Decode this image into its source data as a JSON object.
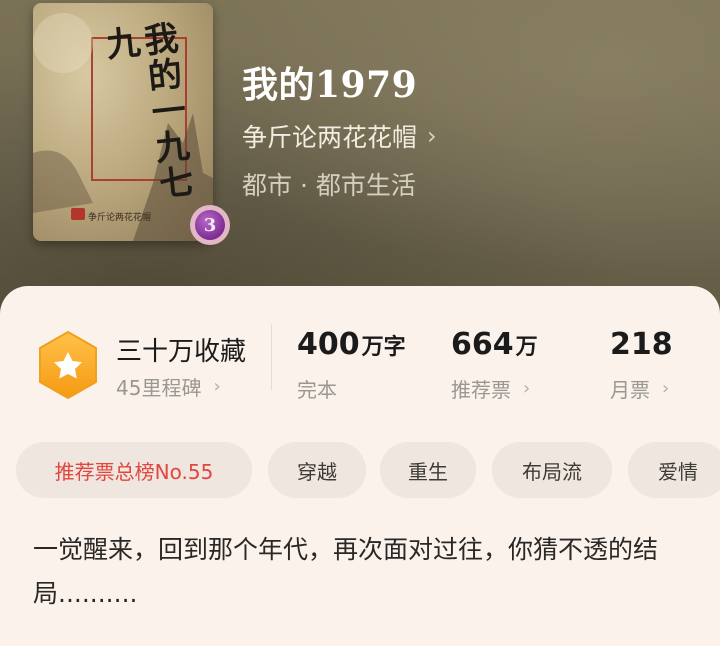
{
  "book": {
    "title": "我的1979",
    "author": "争斤论两花花帽",
    "genre": "都市 · 都市生活",
    "cover_title": "我的一九七九",
    "cover_author": "争斤论两花花帽",
    "level_badge": "3"
  },
  "stats": {
    "collection_label": "三十万收藏",
    "milestone_label": "45里程碑",
    "word_count_number": "400",
    "word_count_unit": "万字",
    "status": "完本",
    "recommend_number": "664",
    "recommend_unit": "万",
    "recommend_label": "推荐票",
    "monthly_number": "218",
    "monthly_label": "月票"
  },
  "tags": [
    "推荐票总榜No.55",
    "穿越",
    "重生",
    "布局流",
    "爱情"
  ],
  "description": "一觉醒来，回到那个年代，再次面对过往，你猜不透的结局..........",
  "icons": {
    "chevron": "›",
    "star": "★"
  },
  "colors": {
    "accent_orange": "#f5a623",
    "rank_red": "#e0473f"
  }
}
